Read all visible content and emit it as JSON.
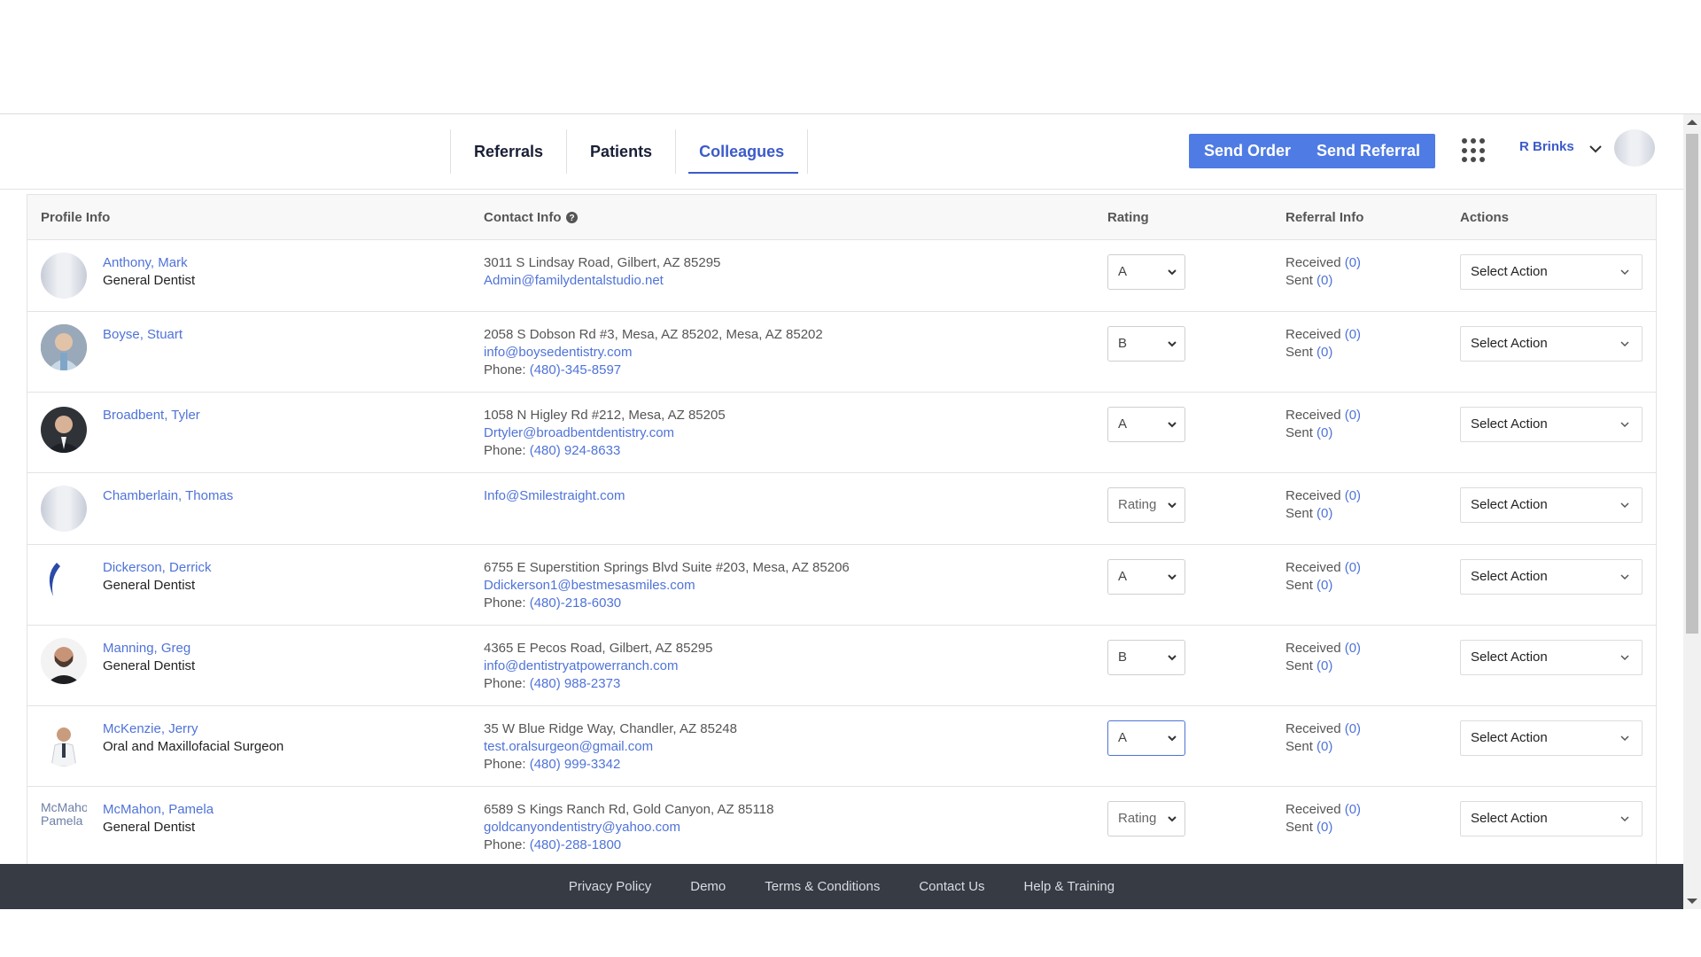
{
  "nav": {
    "tabs": [
      "Referrals",
      "Patients",
      "Colleagues"
    ],
    "active_tab": "Colleagues",
    "send_order": "Send Order",
    "send_referral": "Send Referral",
    "user_name": "R Brinks"
  },
  "table": {
    "headers": {
      "profile": "Profile Info",
      "contact": "Contact Info",
      "rating": "Rating",
      "referral": "Referral Info",
      "actions": "Actions"
    },
    "received_label": "Received",
    "sent_label": "Sent",
    "phone_label": "Phone:",
    "action_placeholder": "Select Action",
    "rows": [
      {
        "name": "Anthony, Mark",
        "specialty": "General Dentist",
        "address": "3011 S Lindsay Road, Gilbert, AZ 85295",
        "email": "Admin@familydentalstudio.net",
        "phone": "",
        "rating": "A",
        "received": "(0)",
        "sent": "(0)"
      },
      {
        "name": "Boyse, Stuart",
        "specialty": "",
        "address": "2058 S Dobson Rd #3, Mesa, AZ 85202, Mesa, AZ 85202",
        "email": "info@boysedentistry.com",
        "phone": "(480)-345-8597",
        "rating": "B",
        "received": "(0)",
        "sent": "(0)"
      },
      {
        "name": "Broadbent, Tyler",
        "specialty": "",
        "address": "1058 N Higley Rd #212, Mesa, AZ 85205",
        "email": "Drtyler@broadbentdentistry.com",
        "phone": "(480) 924-8633",
        "rating": "A",
        "received": "(0)",
        "sent": "(0)"
      },
      {
        "name": "Chamberlain, Thomas",
        "specialty": "",
        "address": "",
        "email": "Info@Smilestraight.com",
        "phone": "",
        "rating": "Rating",
        "received": "(0)",
        "sent": "(0)"
      },
      {
        "name": "Dickerson, Derrick",
        "specialty": "General Dentist",
        "address": "6755 E Superstition Springs Blvd Suite #203, Mesa, AZ 85206",
        "email": "Ddickerson1@bestmesasmiles.com",
        "phone": "(480)-218-6030",
        "rating": "A",
        "received": "(0)",
        "sent": "(0)"
      },
      {
        "name": "Manning, Greg",
        "specialty": "General Dentist",
        "address": "4365 E Pecos Road, Gilbert, AZ 85295",
        "email": "info@dentistryatpowerranch.com",
        "phone": "(480) 988-2373",
        "rating": "B",
        "received": "(0)",
        "sent": "(0)"
      },
      {
        "name": "McKenzie, Jerry",
        "specialty": "Oral and Maxillofacial Surgeon",
        "address": "35 W Blue Ridge Way, Chandler, AZ 85248",
        "email": "test.oralsurgeon@gmail.com",
        "phone": "(480) 999-3342",
        "rating": "A",
        "received": "(0)",
        "sent": "(0)"
      },
      {
        "name": "McMahon, Pamela",
        "specialty": "General Dentist",
        "address": "6589 S Kings Ranch Rd, Gold Canyon, AZ 85118",
        "email": "goldcanyondentistry@yahoo.com",
        "phone": "(480)-288-1800",
        "rating": "Rating",
        "received": "(0)",
        "sent": "(0)",
        "avatar_alt": "McMahon Pamela"
      }
    ]
  },
  "footer": {
    "links": [
      "Privacy Policy",
      "Demo",
      "Terms & Conditions",
      "Contact Us",
      "Help & Training"
    ]
  },
  "colors": {
    "accent": "#4f7be4",
    "link": "#4f73d8",
    "footer_bg": "#363b44"
  }
}
